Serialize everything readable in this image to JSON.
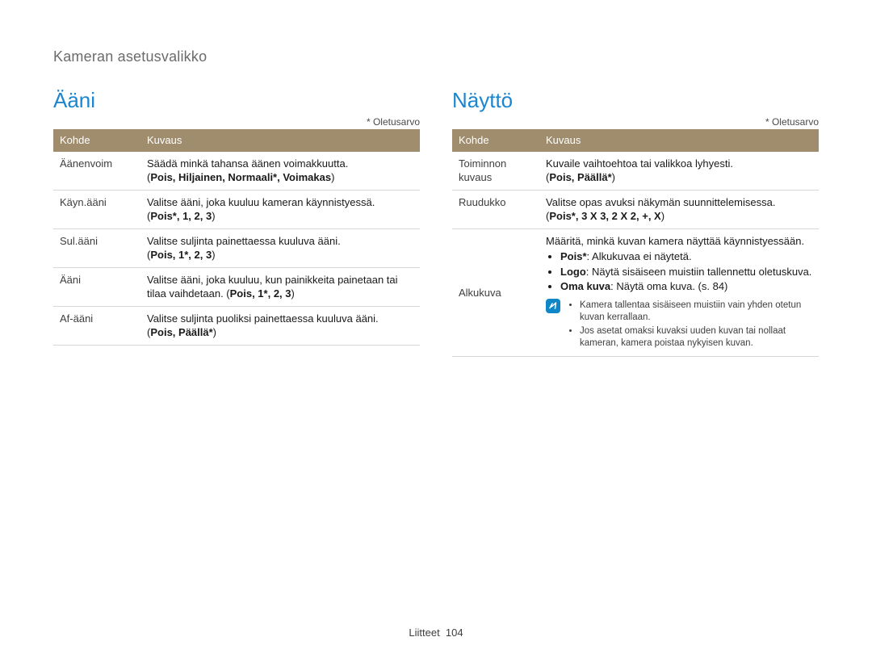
{
  "breadcrumb": "Kameran asetusvalikko",
  "default_note": "* Oletusarvo",
  "headers": {
    "kohde": "Kohde",
    "kuvaus": "Kuvaus"
  },
  "left": {
    "title": "Ääni",
    "rows": [
      {
        "kohde": "Äänenvoim",
        "line1": "Säädä minkä tahansa äänen voimakkuutta.",
        "line2_lead": "(",
        "line2_bold": "Pois, Hiljainen, Normaali*, Voimakas",
        "line2_tail": ")"
      },
      {
        "kohde": "Käyn.ääni",
        "line1": "Valitse ääni, joka kuuluu kameran käynnistyessä.",
        "line2_lead": "(",
        "line2_bold": "Pois*, 1, 2, 3",
        "line2_tail": ")"
      },
      {
        "kohde": "Sul.ääni",
        "line1": "Valitse suljinta painettaessa kuuluva ääni.",
        "line2_lead": "(",
        "line2_bold": "Pois, 1*, 2, 3",
        "line2_tail": ")"
      },
      {
        "kohde": "Ääni",
        "combined_pre": "Valitse ääni, joka kuuluu, kun painikkeita painetaan tai tilaa vaihdetaan. (",
        "combined_bold": "Pois, 1*, 2, 3",
        "combined_post": ")"
      },
      {
        "kohde": "Af-ääni",
        "line1": "Valitse suljinta puoliksi painettaessa kuuluva ääni.",
        "line2_lead": "(",
        "line2_bold": "Pois, Päällä*",
        "line2_tail": ")"
      }
    ]
  },
  "right": {
    "title": "Näyttö",
    "rows": [
      {
        "kohde": "Toiminnon kuvaus",
        "line1": "Kuvaile vaihtoehtoa tai valikkoa lyhyesti.",
        "line2_lead": "(",
        "line2_bold": "Pois, Päällä*",
        "line2_tail": ")"
      },
      {
        "kohde": "Ruudukko",
        "line1": "Valitse opas avuksi näkymän suunnittelemisessa.",
        "line2_lead": "(",
        "line2_bold": "Pois*, 3 X 3, 2 X 2, +, X",
        "line2_tail": ")"
      }
    ],
    "alkukuva": {
      "kohde": "Alkukuva",
      "intro": "Määritä, minkä kuvan kamera näyttää käynnistyessään.",
      "opts": [
        {
          "bold": "Pois*",
          "rest": ": Alkukuvaa ei näytetä."
        },
        {
          "bold": "Logo",
          "rest": ": Näytä sisäiseen muistiin tallennettu oletuskuva."
        },
        {
          "bold": "Oma kuva",
          "rest": ": Näytä oma kuva. (s. 84)"
        }
      ],
      "notes": [
        "Kamera tallentaa sisäiseen muistiin vain yhden otetun kuvan kerrallaan.",
        "Jos asetat omaksi kuvaksi uuden kuvan tai nollaat kameran, kamera poistaa nykyisen kuvan."
      ]
    }
  },
  "footer": {
    "label": "Liitteet",
    "page": "104"
  }
}
